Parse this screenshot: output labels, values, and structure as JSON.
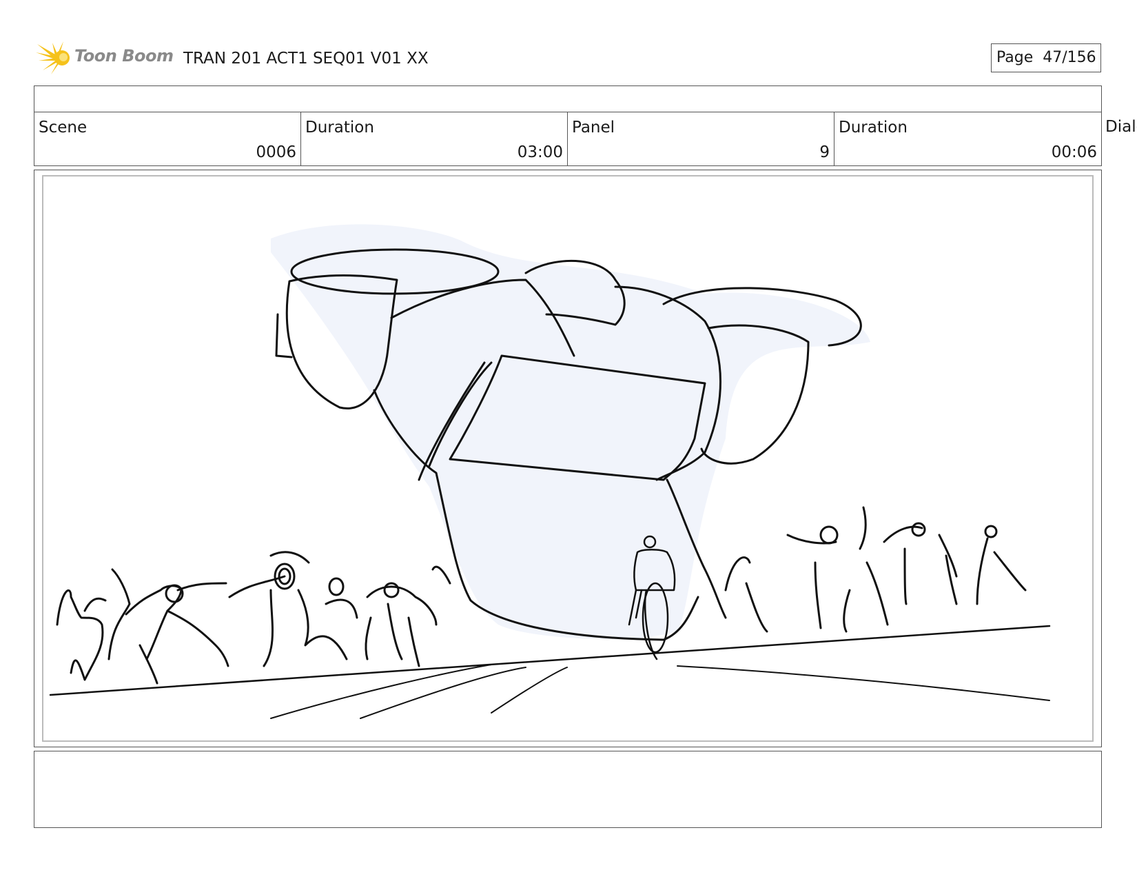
{
  "header": {
    "logo_text": "Toon Boom",
    "title": "TRAN 201 ACT1 SEQ01 V01 XX",
    "page_label": "Page",
    "page_value": "47/156"
  },
  "info": {
    "scene_label": "Scene",
    "scene_value": "0006",
    "scene_duration_label": "Duration",
    "scene_duration_value": "03:00",
    "panel_label": "Panel",
    "panel_value": "9",
    "panel_duration_label": "Duration",
    "panel_duration_value": "00:06",
    "dialogue_label": "Dialo"
  },
  "panel": {
    "sketch": "storyboard-sketch",
    "fill_color": "#f1f4fb",
    "line_color": "#111111"
  }
}
